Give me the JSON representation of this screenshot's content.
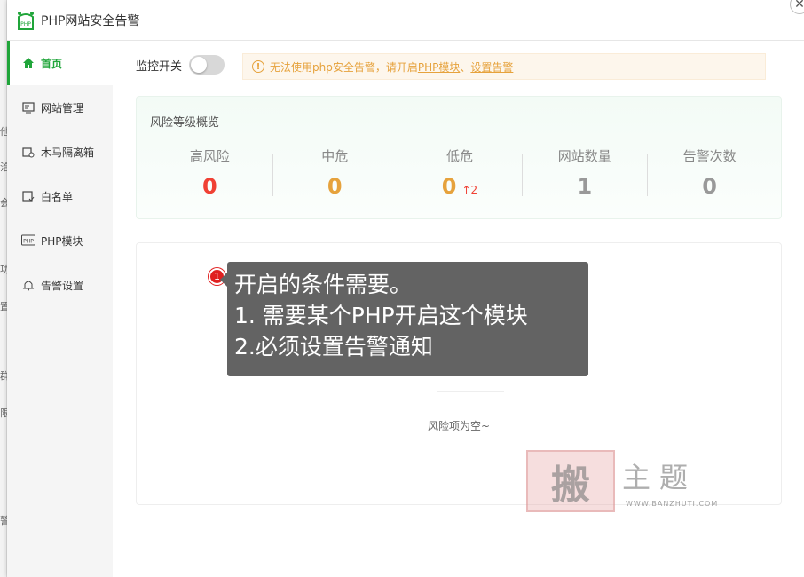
{
  "window": {
    "title": "PHP网站安全告警"
  },
  "sidebar": {
    "items": [
      {
        "label": "首页",
        "icon": "home-icon"
      },
      {
        "label": "网站管理",
        "icon": "site-icon"
      },
      {
        "label": "木马隔离箱",
        "icon": "quarantine-icon"
      },
      {
        "label": "白名单",
        "icon": "whitelist-icon"
      },
      {
        "label": "PHP模块",
        "icon": "php-icon"
      },
      {
        "label": "告警设置",
        "icon": "bell-icon"
      }
    ]
  },
  "topbar": {
    "toggle_label": "监控开关",
    "notice_prefix": "无法使用php安全告警，请开启",
    "notice_link1": "PHP模块",
    "notice_sep": "、",
    "notice_link2": "设置告警"
  },
  "overview": {
    "title": "风险等级概览",
    "stats": [
      {
        "label": "高风险",
        "value": "0",
        "color": "#f04134"
      },
      {
        "label": "中危",
        "value": "0",
        "color": "#e6a23c"
      },
      {
        "label": "低危",
        "value": "0",
        "color": "#e6a23c",
        "trend": "↑2"
      },
      {
        "label": "网站数量",
        "value": "1",
        "color": "#999999"
      },
      {
        "label": "告警次数",
        "value": "0",
        "color": "#999999"
      }
    ]
  },
  "risk_list": {
    "empty_text": "风险项为空~"
  },
  "tooltip": {
    "badge": "1",
    "line1": "开启的条件需要。",
    "line2": "1. 需要某个PHP开启这个模块",
    "line3": "2.必须设置告警通知"
  },
  "watermark": {
    "mark": "搬",
    "text": "主题",
    "url": "WWW.BANZHUTI.COM"
  },
  "colors": {
    "accent": "#20a53a",
    "warning": "#e6a23c",
    "danger": "#f04134"
  }
}
